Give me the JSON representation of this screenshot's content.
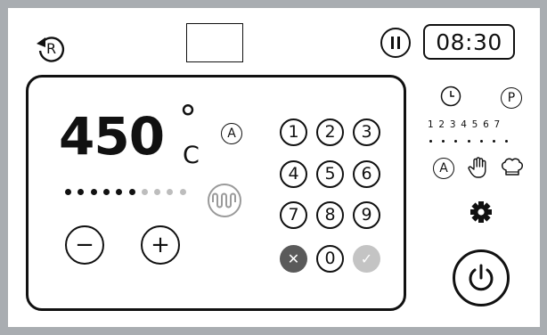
{
  "header": {
    "reset_label": "R",
    "time": "08:30"
  },
  "main": {
    "temperature": "450",
    "degree_symbol": "°",
    "unit": "C",
    "auto_label": "A",
    "heat_level": 6,
    "heat_level_max": 10,
    "minus_label": "−",
    "plus_label": "+"
  },
  "keypad": {
    "keys": [
      "1",
      "2",
      "3",
      "4",
      "5",
      "6",
      "7",
      "8",
      "9"
    ],
    "zero": "0",
    "cancel_glyph": "✕",
    "confirm_glyph": "✓"
  },
  "right_panel": {
    "program_label": "P",
    "weekdays": "1 2 3 4 5 6 7",
    "auto_label": "A"
  },
  "colors": {
    "dark_key": "#5a5a5a",
    "confirm_key": "#c4c4c4",
    "dot_active": "#111111",
    "dot_inactive": "#bdbdbd",
    "heat_icon": "#9a9a9a"
  }
}
